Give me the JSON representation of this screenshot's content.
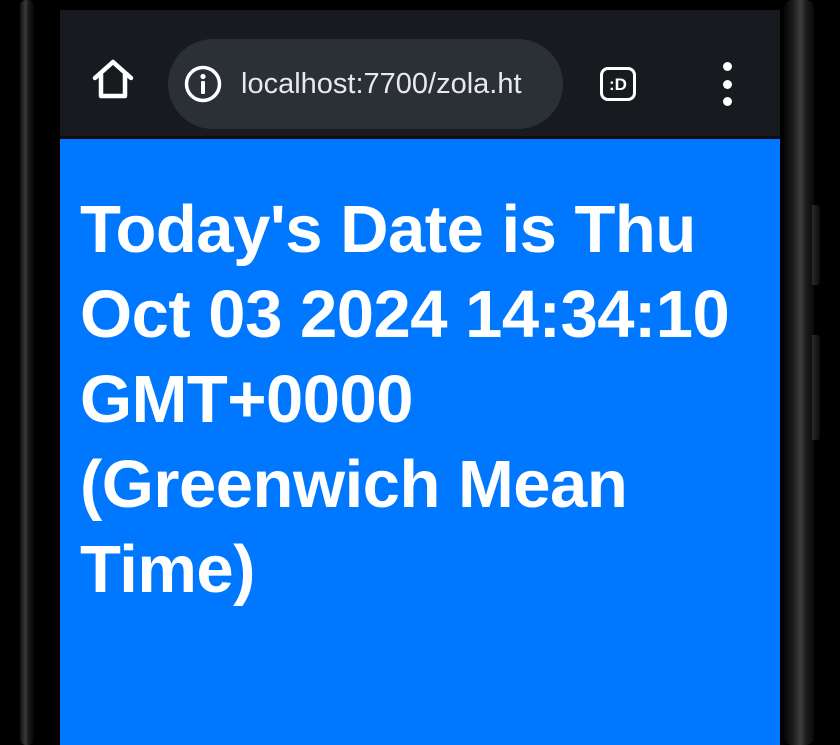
{
  "browser": {
    "url": "localhost:7700/zola.ht",
    "tab_switcher_label": ":D",
    "icons": {
      "home": "home-icon",
      "info": "info-icon",
      "tabs": "tab-switcher-icon",
      "menu": "more-vert-icon"
    }
  },
  "page": {
    "heading": "Today's Date is Thu Oct 03 2024 14:34:10 GMT+0000 (Greenwich Mean Time)",
    "background_color": "#0077ff",
    "text_color": "#ffffff"
  },
  "colors": {
    "toolbar": "#171b20",
    "url_bar": "#2a3036"
  }
}
